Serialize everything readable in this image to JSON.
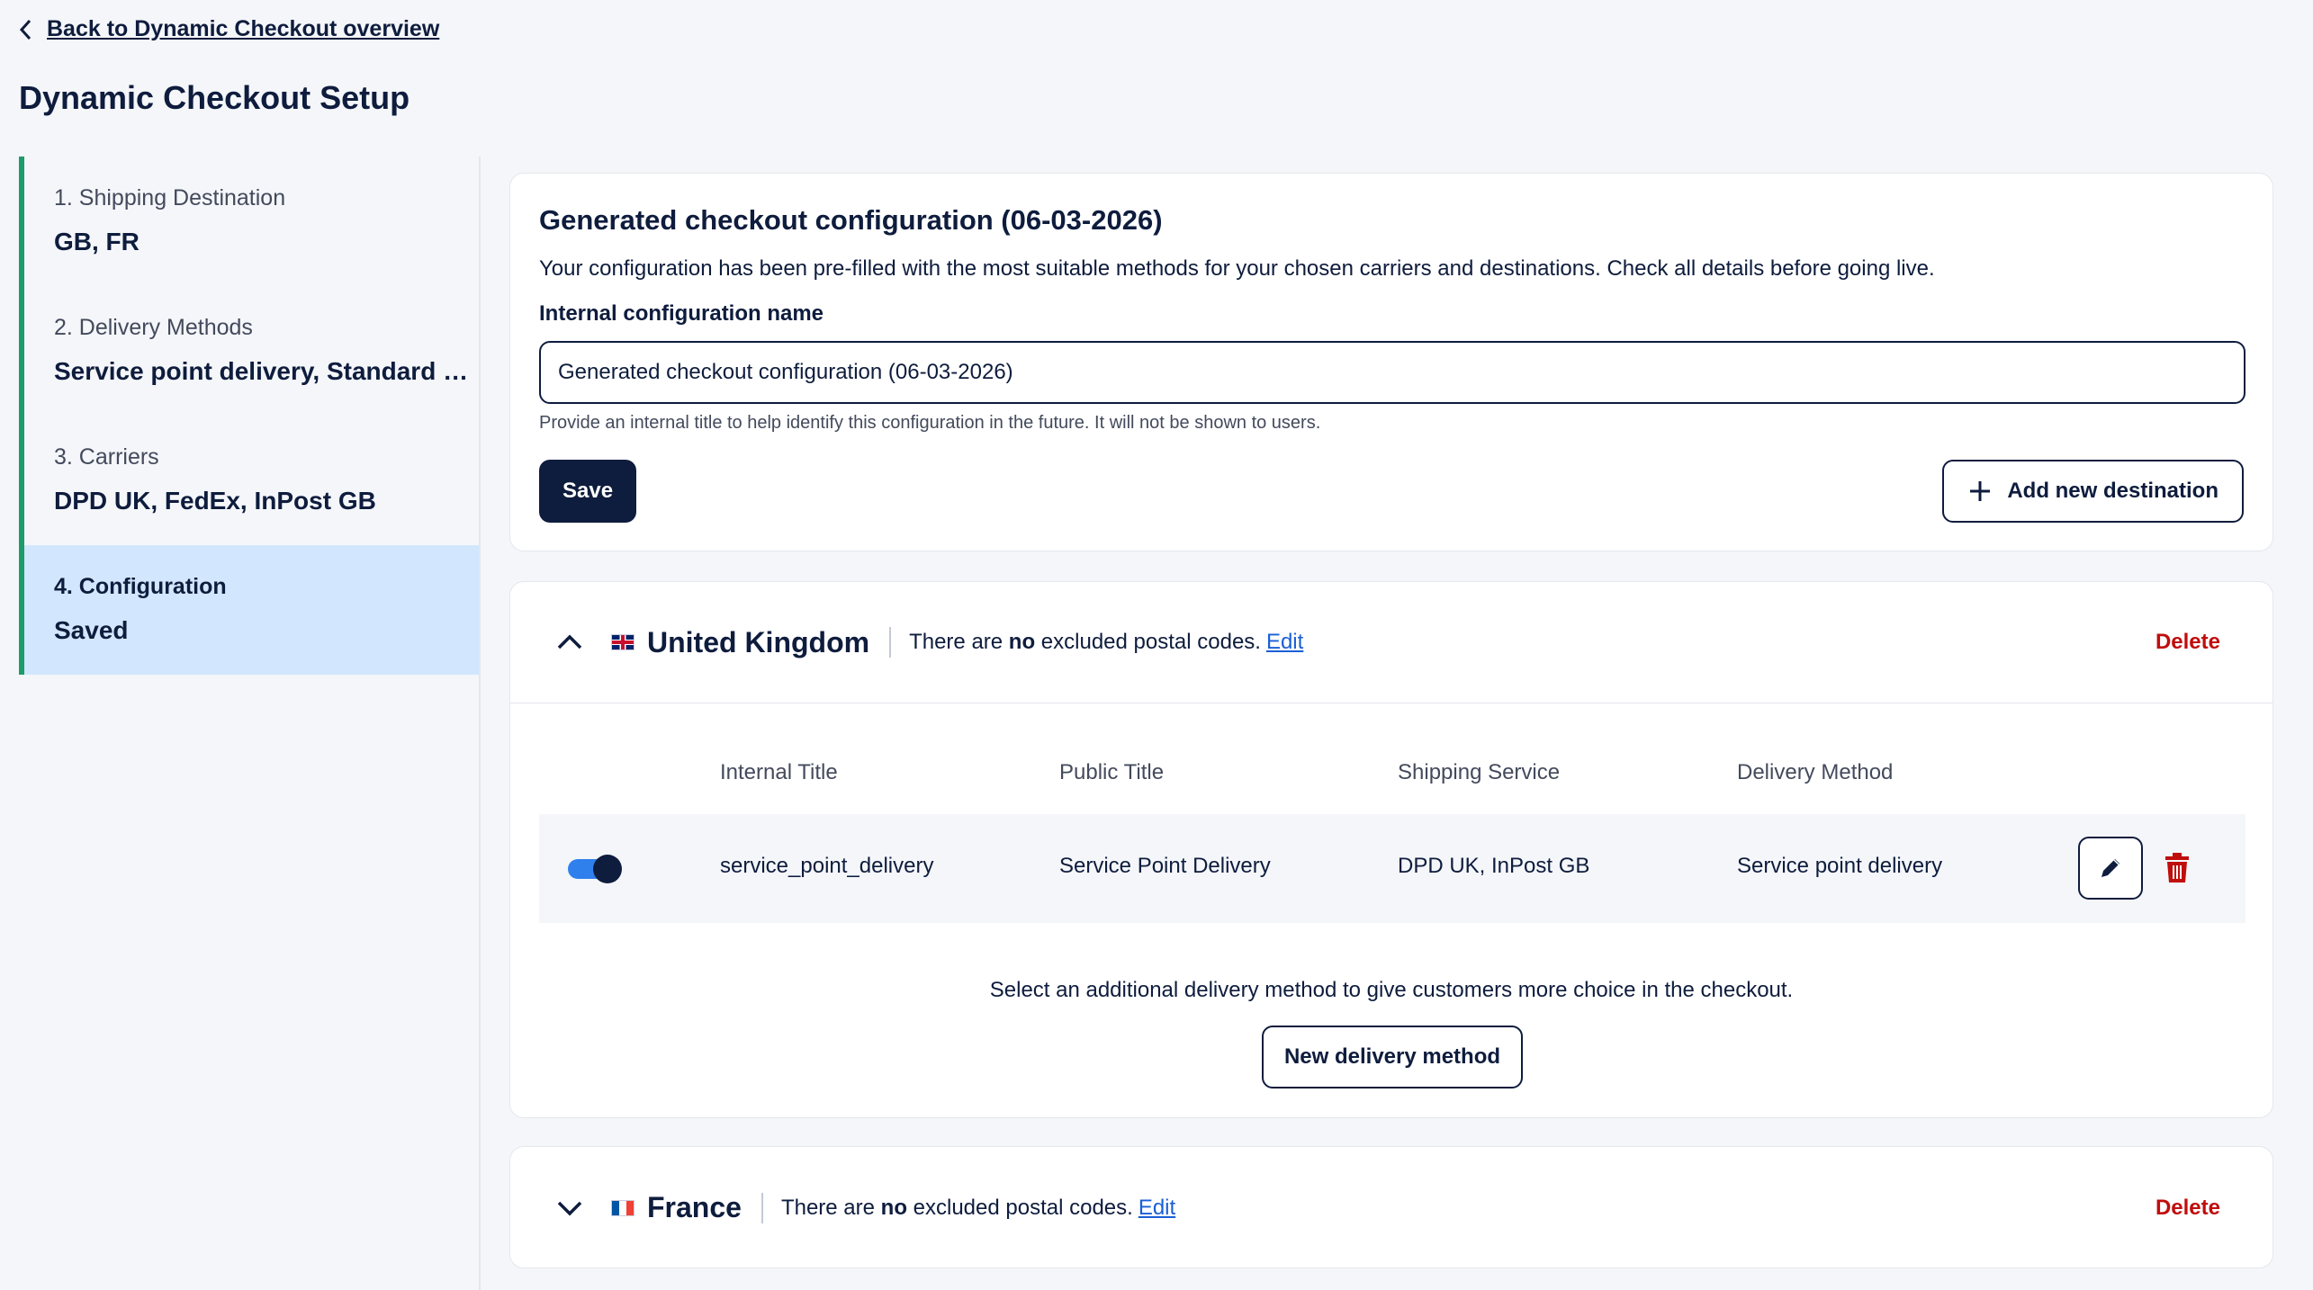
{
  "nav": {
    "back_label": "Back to Dynamic Checkout overview"
  },
  "page": {
    "title": "Dynamic Checkout Setup"
  },
  "steps": [
    {
      "label": "1. Shipping Destination",
      "value": "GB, FR"
    },
    {
      "label": "2. Delivery Methods",
      "value": "Service point delivery, Standard delivery"
    },
    {
      "label": "3. Carriers",
      "value": "DPD UK, FedEx, InPost GB"
    },
    {
      "label": "4. Configuration",
      "value": "Saved"
    }
  ],
  "config": {
    "title": "Generated checkout configuration (06-03-2026)",
    "description": "Your configuration has been pre-filled with the most suitable methods for your chosen carriers and destinations. Check all details before going live.",
    "name_label": "Internal configuration name",
    "name_value": "Generated checkout configuration (06-03-2026)",
    "hint": "Provide an internal title to help identify this configuration in the future. It will not be shown to users.",
    "save_label": "Save",
    "add_destination_label": "Add new destination"
  },
  "destinations": [
    {
      "name": "United Kingdom",
      "excluded_prefix": "There are ",
      "excluded_bold": "no",
      "excluded_suffix": " excluded postal codes.",
      "edit_label": "Edit",
      "delete_label": "Delete",
      "expanded": true,
      "columns": [
        "Internal Title",
        "Public Title",
        "Shipping Service",
        "Delivery Method"
      ],
      "rows": [
        {
          "enabled": true,
          "internal_title": "service_point_delivery",
          "public_title": "Service Point Delivery",
          "shipping_service": "DPD UK, InPost GB",
          "delivery_method": "Service point delivery"
        }
      ],
      "add_text": "Select an additional delivery method to give customers more choice in the checkout.",
      "new_method_label": "New delivery method"
    },
    {
      "name": "France",
      "excluded_prefix": "There are ",
      "excluded_bold": "no",
      "excluded_suffix": " excluded postal codes.",
      "edit_label": "Edit",
      "delete_label": "Delete",
      "expanded": false
    }
  ],
  "colors": {
    "primary": "#0e1c3d",
    "accent_green": "#1b9c6a",
    "active_step_bg": "#d2e7fd",
    "danger": "#c00d0d",
    "link": "#1a5fd6",
    "toggle_on": "#2f80ed"
  },
  "icons": [
    "chevron-left-icon",
    "plus-icon",
    "chevron-up-icon",
    "chevron-down-icon",
    "uk-flag-icon",
    "fr-flag-icon",
    "pencil-icon",
    "trash-icon"
  ]
}
